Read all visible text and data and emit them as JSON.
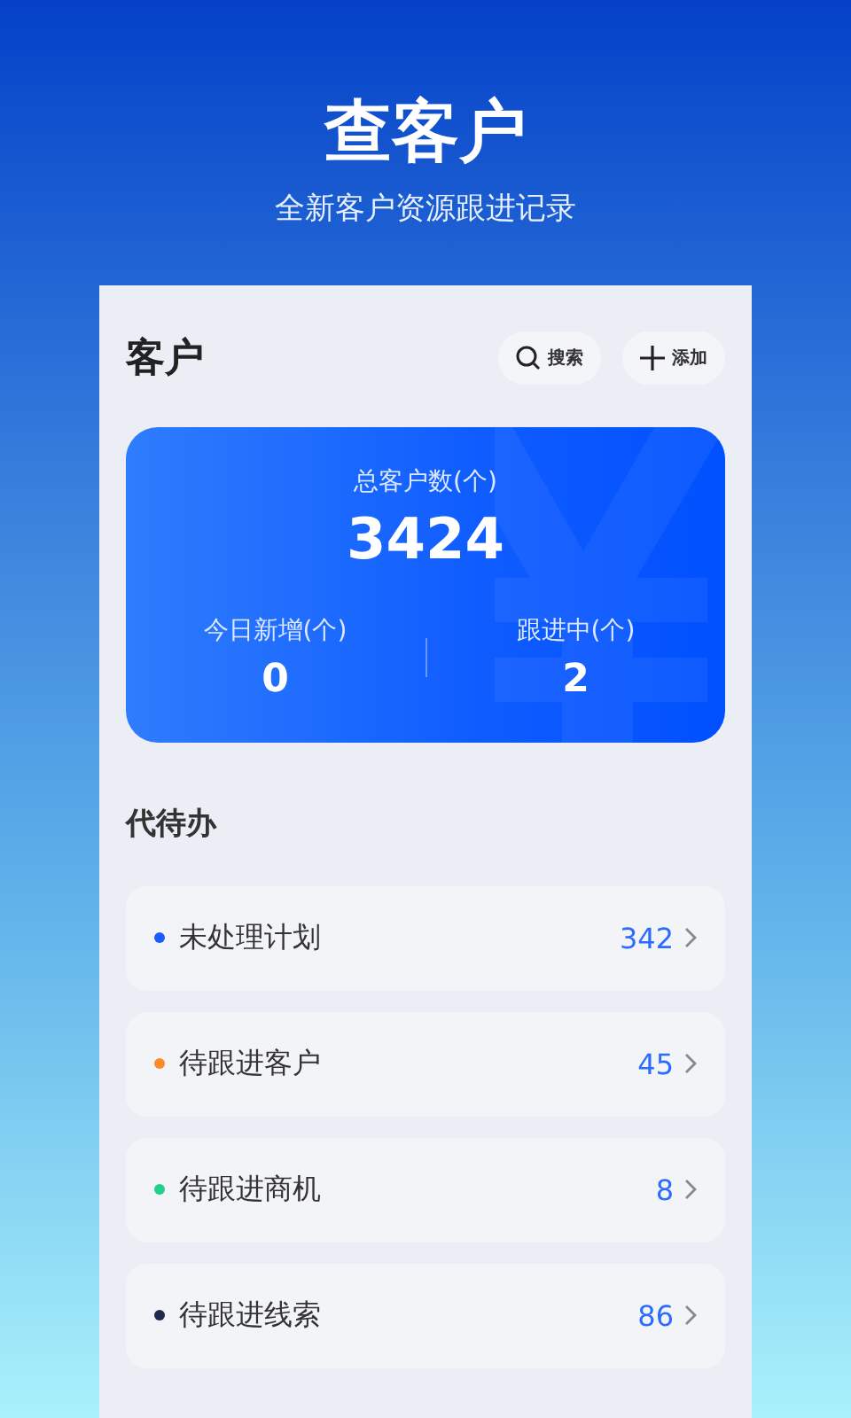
{
  "header": {
    "title": "查客户",
    "subtitle": "全新客户资源跟进记录"
  },
  "panel": {
    "title": "客户",
    "buttons": [
      {
        "kind": "search",
        "label": "搜索"
      },
      {
        "kind": "add",
        "label": "添加"
      }
    ]
  },
  "summary": {
    "total_label": "总客户数(个)",
    "total": "3424",
    "stats": [
      {
        "label": "今日新增(个)",
        "value": "0"
      },
      {
        "label": "跟进中(个)",
        "value": "2"
      }
    ]
  },
  "todo": {
    "title": "代待办",
    "items": [
      {
        "label": "未处理计划",
        "count": "342",
        "color": "#1a5cff"
      },
      {
        "label": "待跟进客户",
        "count": "45",
        "color": "#ff8a2a"
      },
      {
        "label": "待跟进商机",
        "count": "8",
        "color": "#22d08a"
      },
      {
        "label": "待跟进线索",
        "count": "86",
        "color": "#1d2a4a"
      }
    ]
  }
}
